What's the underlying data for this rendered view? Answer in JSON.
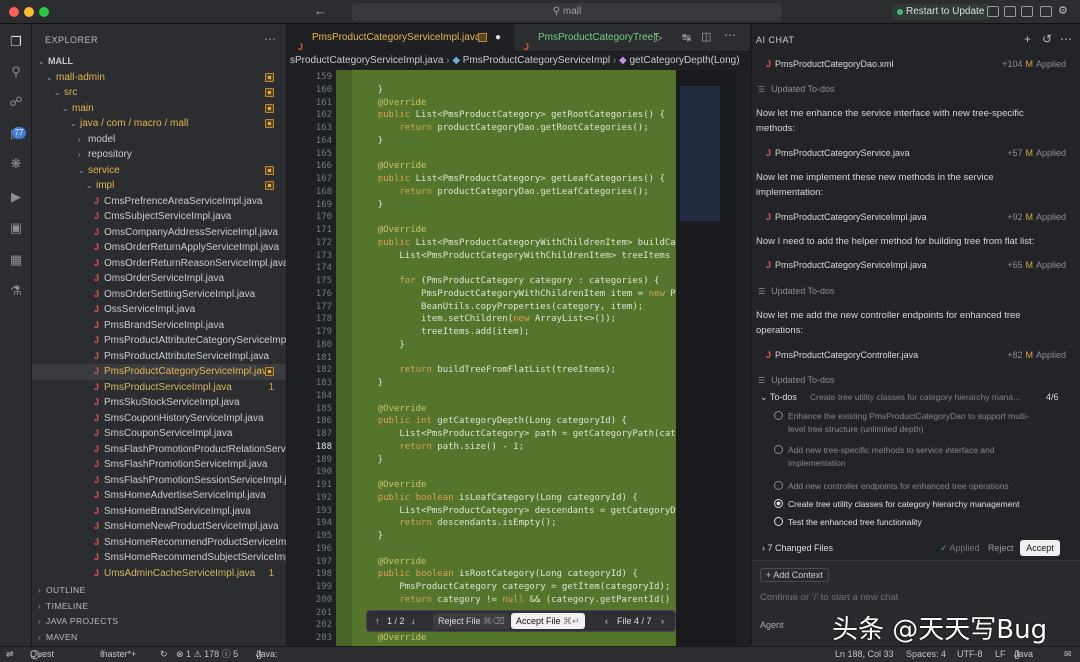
{
  "titlebar": {
    "search": "mall",
    "restart_label": "Restart to Update"
  },
  "activity": {
    "scm_badge": "77",
    "icons": [
      "files-icon",
      "search-icon",
      "source-control-icon",
      "run-icon",
      "extensions-icon",
      "debug-icon",
      "remote-icon",
      "test-icon",
      "flask-icon"
    ]
  },
  "sidebar": {
    "title": "EXPLORER",
    "tree": [
      {
        "label": "MALL",
        "depth": 0,
        "chev": "v",
        "cls": "root"
      },
      {
        "label": "mall-admin",
        "depth": 1,
        "chev": "v",
        "cls": "mod",
        "mark": true
      },
      {
        "label": "src",
        "depth": 2,
        "chev": "v",
        "cls": "mod",
        "mark": true
      },
      {
        "label": "main",
        "depth": 3,
        "chev": "v",
        "cls": "mod",
        "mark": true
      },
      {
        "label": "java / com / macro / mall",
        "depth": 4,
        "chev": "v",
        "cls": "mod",
        "mark": true
      },
      {
        "label": "model",
        "depth": 5,
        "chev": ">",
        "cls": ""
      },
      {
        "label": "repository",
        "depth": 5,
        "chev": ">",
        "cls": ""
      },
      {
        "label": "service",
        "depth": 5,
        "chev": "v",
        "cls": "mod",
        "mark": true
      },
      {
        "label": "impl",
        "depth": 6,
        "chev": "v",
        "cls": "mod",
        "mark": true
      },
      {
        "label": "CmsPrefrenceAreaServiceImpl.java",
        "depth": 7,
        "java": true
      },
      {
        "label": "CmsSubjectServiceImpl.java",
        "depth": 7,
        "java": true
      },
      {
        "label": "OmsCompanyAddressServiceImpl.java",
        "depth": 7,
        "java": true
      },
      {
        "label": "OmsOrderReturnApplyServiceImpl.java",
        "depth": 7,
        "java": true
      },
      {
        "label": "OmsOrderReturnReasonServiceImpl.java",
        "depth": 7,
        "java": true
      },
      {
        "label": "OmsOrderServiceImpl.java",
        "depth": 7,
        "java": true
      },
      {
        "label": "OmsOrderSettingServiceImpl.java",
        "depth": 7,
        "java": true
      },
      {
        "label": "OssServiceImpl.java",
        "depth": 7,
        "java": true
      },
      {
        "label": "PmsBrandServiceImpl.java",
        "depth": 7,
        "java": true
      },
      {
        "label": "PmsProductAttributeCategoryServiceImpl.ja...",
        "depth": 7,
        "java": true
      },
      {
        "label": "PmsProductAttributeServiceImpl.java",
        "depth": 7,
        "java": true
      },
      {
        "label": "PmsProductCategoryServiceImpl.java",
        "depth": 7,
        "java": true,
        "cls": "mod sel",
        "mark": true
      },
      {
        "label": "PmsProductServiceImpl.java",
        "depth": 7,
        "java": true,
        "cls": "mod2",
        "num": "1"
      },
      {
        "label": "PmsSkuStockServiceImpl.java",
        "depth": 7,
        "java": true
      },
      {
        "label": "SmsCouponHistoryServiceImpl.java",
        "depth": 7,
        "java": true
      },
      {
        "label": "SmsCouponServiceImpl.java",
        "depth": 7,
        "java": true
      },
      {
        "label": "SmsFlashPromotionProductRelationServiceI...",
        "depth": 7,
        "java": true
      },
      {
        "label": "SmsFlashPromotionServiceImpl.java",
        "depth": 7,
        "java": true
      },
      {
        "label": "SmsFlashPromotionSessionServiceImpl.java",
        "depth": 7,
        "java": true
      },
      {
        "label": "SmsHomeAdvertiseServiceImpl.java",
        "depth": 7,
        "java": true
      },
      {
        "label": "SmsHomeBrandServiceImpl.java",
        "depth": 7,
        "java": true
      },
      {
        "label": "SmsHomeNewProductServiceImpl.java",
        "depth": 7,
        "java": true
      },
      {
        "label": "SmsHomeRecommendProductServiceImpl.j...",
        "depth": 7,
        "java": true
      },
      {
        "label": "SmsHomeRecommendSubjectServiceImpl.j...",
        "depth": 7,
        "java": true
      },
      {
        "label": "UmsAdminCacheServiceImpl.java",
        "depth": 7,
        "java": true,
        "cls": "mod2",
        "num": "1"
      }
    ],
    "sections": [
      "OUTLINE",
      "TIMELINE",
      "JAVA PROJECTS",
      "MAVEN"
    ]
  },
  "editor": {
    "tab1": "PmsProductCategoryServiceImpl.java",
    "tab2": "PmsProductCategoryTreeT",
    "breadcrumb": [
      "sProductCategoryServiceImpl.java",
      "PmsProductCategoryServiceImpl",
      "getCategoryDepth(Long)"
    ],
    "lines": [
      {
        "n": "159",
        "t": ""
      },
      {
        "n": "160",
        "t": "    }"
      },
      {
        "n": "161",
        "t": "    @Override"
      },
      {
        "n": "162",
        "t": "    public List<PmsProductCategory> getRootCategories() {"
      },
      {
        "n": "163",
        "t": "        return productCategoryDao.getRootCategories();"
      },
      {
        "n": "164",
        "t": "    }"
      },
      {
        "n": "165",
        "t": ""
      },
      {
        "n": "166",
        "t": "    @Override"
      },
      {
        "n": "167",
        "t": "    public List<PmsProductCategory> getLeafCategories() {"
      },
      {
        "n": "168",
        "t": "        return productCategoryDao.getLeafCategories();"
      },
      {
        "n": "169",
        "t": "    }"
      },
      {
        "n": "170",
        "t": ""
      },
      {
        "n": "171",
        "t": "    @Override"
      },
      {
        "n": "172",
        "t": "    public List<PmsProductCategoryWithChildrenItem> buildCategoryTr"
      },
      {
        "n": "173",
        "t": "        List<PmsProductCategoryWithChildrenItem> treeItems = new Ar"
      },
      {
        "n": "174",
        "t": ""
      },
      {
        "n": "175",
        "t": "        for (PmsProductCategory category : categories) {"
      },
      {
        "n": "176",
        "t": "            PmsProductCategoryWithChildrenItem item = new PmsProduc"
      },
      {
        "n": "177",
        "t": "            BeanUtils.copyProperties(category, item);"
      },
      {
        "n": "178",
        "t": "            item.setChildren(new ArrayList<>());"
      },
      {
        "n": "179",
        "t": "            treeItems.add(item);"
      },
      {
        "n": "180",
        "t": "        }"
      },
      {
        "n": "181",
        "t": ""
      },
      {
        "n": "182",
        "t": "        return buildTreeFromFlatList(treeItems);"
      },
      {
        "n": "183",
        "t": "    }"
      },
      {
        "n": "184",
        "t": ""
      },
      {
        "n": "185",
        "t": "    @Override"
      },
      {
        "n": "186",
        "t": "    public int getCategoryDepth(Long categoryId) {"
      },
      {
        "n": "187",
        "t": "        List<PmsProductCategory> path = getCategoryPath(categoryId"
      },
      {
        "n": "188",
        "t": "        return path.size() - 1;"
      },
      {
        "n": "189",
        "t": "    }"
      },
      {
        "n": "190",
        "t": ""
      },
      {
        "n": "191",
        "t": "    @Override"
      },
      {
        "n": "192",
        "t": "    public boolean isLeafCategory(Long categoryId) {"
      },
      {
        "n": "193",
        "t": "        List<PmsProductCategory> descendants = getCategoryDescendar"
      },
      {
        "n": "194",
        "t": "        return descendants.isEmpty();"
      },
      {
        "n": "195",
        "t": "    }"
      },
      {
        "n": "196",
        "t": ""
      },
      {
        "n": "197",
        "t": "    @Override"
      },
      {
        "n": "198",
        "t": "    public boolean isRootCategory(Long categoryId) {"
      },
      {
        "n": "199",
        "t": "        PmsProductCategory category = getItem(categoryId);"
      },
      {
        "n": "200",
        "t": "        return category != null && (category.getParentId() == null"
      },
      {
        "n": "201",
        "t": ""
      },
      {
        "n": "202",
        "t": "    }"
      },
      {
        "n": "203",
        "t": "    @Override"
      }
    ],
    "nav": {
      "count": "1 / 2",
      "reject": "Reject File",
      "reject_kbd": "⌘⌫",
      "accept": "Accept File",
      "accept_kbd": "⌘↵",
      "file": "File 4 / 7"
    }
  },
  "chat": {
    "title": "AI CHAT",
    "items": [
      {
        "type": "file",
        "name": "PmsProductCategoryDao.xml",
        "plus": "+104",
        "m": "M",
        "state": "Applied"
      },
      {
        "type": "upd",
        "text": "Updated To-dos"
      },
      {
        "type": "msg",
        "text": "Now let me enhance the service interface with new tree-specific methods:"
      },
      {
        "type": "file",
        "name": "PmsProductCategoryService.java",
        "plus": "+57",
        "m": "M",
        "state": "Applied"
      },
      {
        "type": "msg",
        "text": "Now let me implement these new methods in the service implementation:"
      },
      {
        "type": "file",
        "name": "PmsProductCategoryServiceImpl.java",
        "plus": "+92",
        "m": "M",
        "state": "Applied"
      },
      {
        "type": "msg",
        "text": "Now I need to add the helper method for building tree from flat list:"
      },
      {
        "type": "file",
        "name": "PmsProductCategoryServiceImpl.java",
        "plus": "+65",
        "m": "M",
        "state": "Applied"
      },
      {
        "type": "upd",
        "text": "Updated To-dos"
      },
      {
        "type": "msg",
        "text": "Now let me add the new controller endpoints for enhanced tree operations:"
      },
      {
        "type": "file",
        "name": "PmsProductCategoryController.java",
        "plus": "+82",
        "m": "M",
        "state": "Applied"
      },
      {
        "type": "upd",
        "text": "Updated To-dos"
      }
    ],
    "todos_header": {
      "label": "To-dos",
      "current": "Create tree utility classes for category hierarchy mana...",
      "count": "4/6"
    },
    "todos": [
      {
        "text": "Enhance the existing PmsProductCategoryDao to support multi-level tree structure (unlimited depth)",
        "done": true
      },
      {
        "text": "Add new tree-specific methods to service interface and implementation",
        "done": true
      },
      {
        "text": "Add new controller endpoints for enhanced tree operations",
        "done": true
      },
      {
        "text": "Create tree utility classes for category hierarchy management",
        "active": true
      },
      {
        "text": "Test the enhanced tree functionality",
        "done": false
      }
    ],
    "changed": {
      "label": "7 Changed Files",
      "applied": "Applied",
      "reject": "Reject",
      "accept": "Accept"
    },
    "add_context": "+ Add Context",
    "input_placeholder": "Continue or '/' to start a new chat",
    "agent": "Agent",
    "watermark": "头条 @天天写Bug"
  },
  "status": {
    "mode": "Quest Mode",
    "branch": "master*+",
    "problems": "⊗ 1 ⚠ 178 ⓘ 5",
    "java": "Java: Ready",
    "pos": "Ln 188, Col 33",
    "spaces": "Spaces: 4",
    "enc": "UTF-8",
    "eol": "LF",
    "lang": "Java"
  }
}
